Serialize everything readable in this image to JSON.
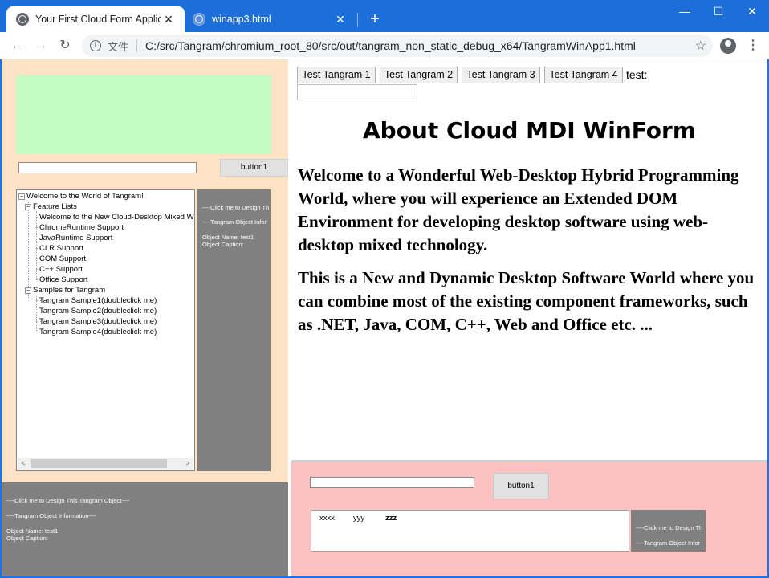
{
  "browser": {
    "tabs": [
      {
        "title": "Your First Cloud Form Applicati",
        "active": true,
        "close": "✕"
      },
      {
        "title": "winapp3.html",
        "active": false,
        "close": "✕"
      }
    ],
    "new_tab": "+",
    "window_controls": {
      "minimize": "—",
      "maximize": "☐",
      "close": "✕"
    },
    "nav": {
      "back": "←",
      "forward": "→",
      "reload": "↻"
    },
    "omnibox": {
      "info": "i",
      "chip": "文件",
      "url": "C:/src/Tangram/chromium_root_80/src/out/tangram_non_static_debug_x64/TangramWinApp1.html",
      "star": "☆"
    },
    "menu": "⋮"
  },
  "left_pane": {
    "input_value": "",
    "button_label": "button1",
    "tree": [
      {
        "label": "Welcome to the World of Tangram!",
        "level": 0,
        "expander": "−"
      },
      {
        "label": "Feature Lists",
        "level": 1,
        "expander": "−"
      },
      {
        "label": "Welcome to the New Cloud-Desktop Mixed W",
        "level": 2
      },
      {
        "label": "ChromeRuntime Support",
        "level": 2
      },
      {
        "label": "JavaRuntime Support",
        "level": 2
      },
      {
        "label": "CLR Support",
        "level": 2
      },
      {
        "label": "COM Support",
        "level": 2
      },
      {
        "label": "C++ Support",
        "level": 2
      },
      {
        "label": "Office Support",
        "level": 2
      },
      {
        "label": "Samples for Tangram",
        "level": 1,
        "expander": "−"
      },
      {
        "label": "Tangram Sample1(doubleclick me)",
        "level": 2
      },
      {
        "label": "Tangram Sample2(doubleclick me)",
        "level": 2
      },
      {
        "label": "Tangram Sample3(doubleclick me)",
        "level": 2
      },
      {
        "label": "Tangram Sample4(doubleclick me)",
        "level": 2
      }
    ],
    "scroll": {
      "left": "<",
      "right": ">"
    },
    "side_info": {
      "design": "----Click me to Design Th",
      "info": "----Tangram Object Infor",
      "name": "Object Name:  test1",
      "caption": "Object Caption:"
    }
  },
  "bottom_left": {
    "design": "----Click me to Design This Tangram Object----",
    "info": "----Tangram Object Information----",
    "name": "Object Name:   test1",
    "caption": "Object Caption:"
  },
  "right_pane": {
    "buttons": [
      "Test Tangram 1",
      "Test Tangram 2",
      "Test Tangram 3",
      "Test Tangram 4"
    ],
    "test_label": "test:",
    "test_input": "",
    "title": "About Cloud MDI WinForm",
    "para1": "Welcome to a Wonderful Web-Desktop Hybrid Programming World, where you will experience an Extended DOM Environment for developing desktop software using web-desktop mixed technology.",
    "para2": "This is a New and Dynamic Desktop Software World where you can combine most of the existing component frameworks, such as .NET, Java, COM, C++, Web and Office etc. ..."
  },
  "pink_pane": {
    "input_value": "",
    "button_label": "button1",
    "list_items": [
      "xxxx",
      "yyy",
      "zzz"
    ],
    "side_info": {
      "design": "----Click me to Design Th",
      "info": "----Tangram Object Infor"
    }
  },
  "colors": {
    "titlebar": "#1c6ed8",
    "left_pane_bg": "#fde2c5",
    "green_box": "#c2fcc0",
    "gray_panel": "#808080",
    "pink_pane_bg": "#fdc1c1"
  }
}
